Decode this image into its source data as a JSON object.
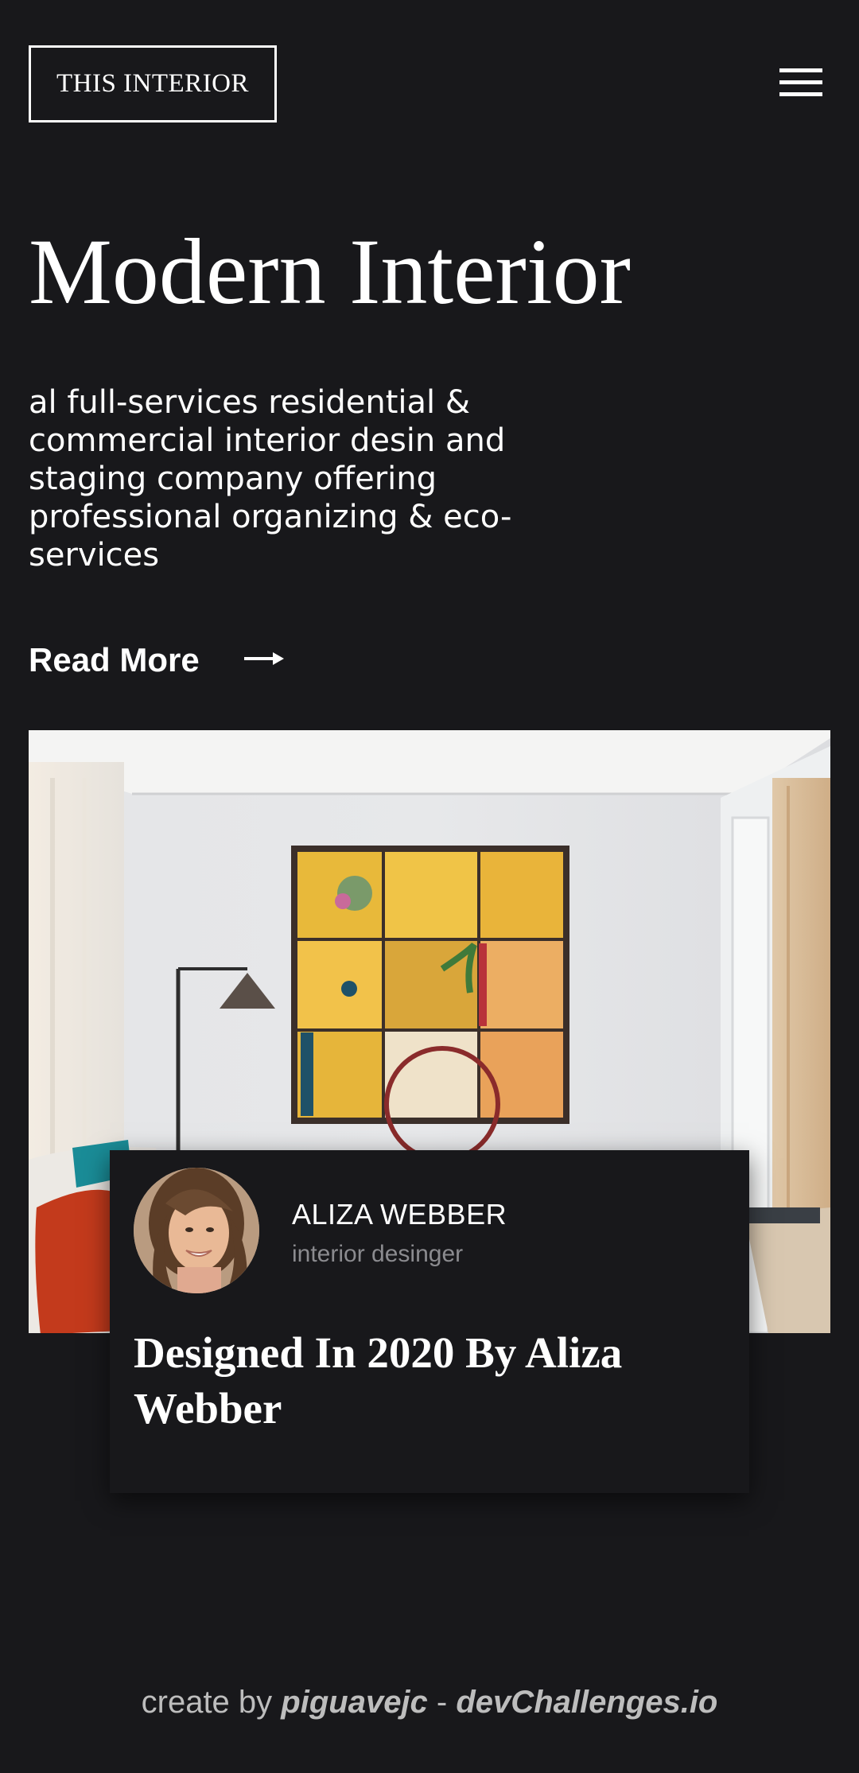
{
  "header": {
    "logo_text": "THIS INTERIOR",
    "menu_icon": "hamburger-menu-icon"
  },
  "hero": {
    "title": "Modern Interior",
    "description": "al full-services residential & commercial interior desin and staging company offering professional organizing & eco-services",
    "read_more_label": "Read More",
    "read_more_icon": "arrow-right-icon"
  },
  "feature": {
    "image_subject": "interior-room-photo",
    "designer_name": "ALIZA WEBBER",
    "designer_role": "interior desinger",
    "card_title": "Designed In 2020 By Aliza Webber"
  },
  "footer": {
    "prefix": "create by",
    "author": "piguavejc",
    "separator": "-",
    "site": "devChallenges.io"
  },
  "colors": {
    "background": "#18181b",
    "text": "#ffffff",
    "muted": "#8b8b8f",
    "footer_text": "#bdbdbd"
  }
}
